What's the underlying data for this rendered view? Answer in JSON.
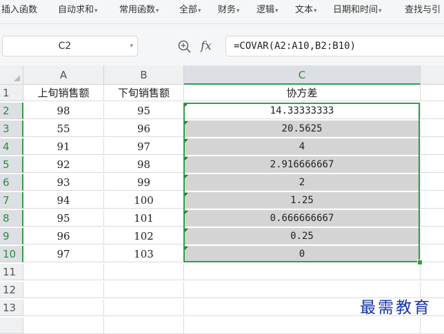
{
  "ribbon": {
    "items": [
      {
        "label": "插入函数",
        "has_arrow": false
      },
      {
        "label": "自动求和",
        "has_arrow": true
      },
      {
        "label": "常用函数",
        "has_arrow": true
      },
      {
        "label": "全部",
        "has_arrow": true
      },
      {
        "label": "财务",
        "has_arrow": true
      },
      {
        "label": "逻辑",
        "has_arrow": true
      },
      {
        "label": "文本",
        "has_arrow": true
      },
      {
        "label": "日期和时间",
        "has_arrow": true
      },
      {
        "label": "查找与引",
        "has_arrow": false
      }
    ]
  },
  "formula_bar": {
    "name_box": "C2",
    "fx_label": "fx",
    "formula": "=COVAR(A2:A10,B2:B10)"
  },
  "grid": {
    "columns": [
      "A",
      "B",
      "C"
    ],
    "selected_column": "C",
    "row_numbers": [
      "1",
      "2",
      "3",
      "4",
      "5",
      "6",
      "7",
      "8",
      "9",
      "10",
      "11",
      "12",
      "13"
    ],
    "header_row": [
      "上旬销售额",
      "下旬销售额",
      "协方差"
    ],
    "rows": [
      [
        "98",
        "95",
        "14.33333333"
      ],
      [
        "55",
        "96",
        "20.5625"
      ],
      [
        "91",
        "97",
        "4"
      ],
      [
        "92",
        "98",
        "2.916666667"
      ],
      [
        "93",
        "99",
        "2"
      ],
      [
        "94",
        "100",
        "1.25"
      ],
      [
        "95",
        "101",
        "0.666666667"
      ],
      [
        "96",
        "102",
        "0.25"
      ],
      [
        "97",
        "103",
        "0"
      ]
    ]
  },
  "watermark": "最需教育",
  "colors": {
    "selection_green": "#2e9e47",
    "range_fill": "#d4d4d4",
    "watermark_blue": "#1533a8"
  }
}
